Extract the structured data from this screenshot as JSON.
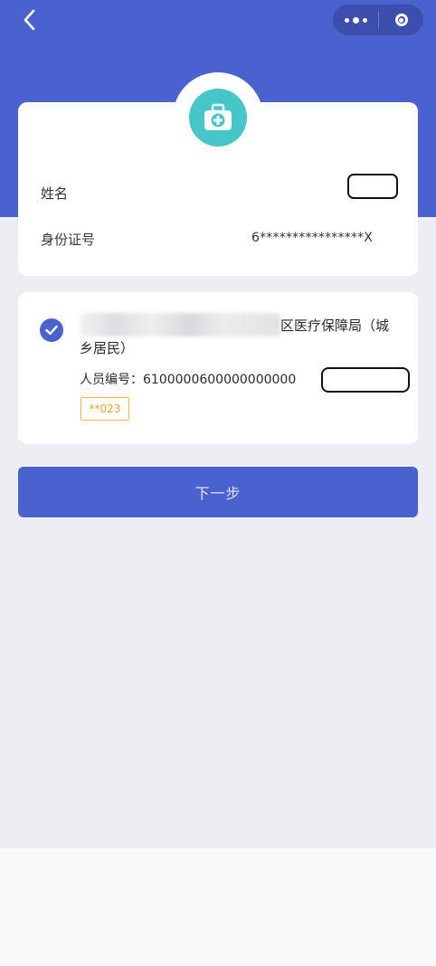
{
  "nav": {
    "back_icon": "chevron-left-icon",
    "more_icon": "more-dots-icon",
    "close_icon": "target-ring-icon"
  },
  "identity_card": {
    "icon": "medical-kit-icon",
    "name_label": "姓名",
    "id_label": "身份证号",
    "id_value": "6****************X"
  },
  "insurance_card": {
    "agency_visible": "区医疗保障局（城",
    "agency_line2": "乡居民）",
    "member_no_label": "人员编号：",
    "member_no_value": "6100000600000000000",
    "tag": "**023"
  },
  "actions": {
    "next_label": "下一步"
  },
  "colors": {
    "brand": "#4a62cd",
    "medkit": "#46c6c7",
    "tag": "#e8a92a"
  }
}
